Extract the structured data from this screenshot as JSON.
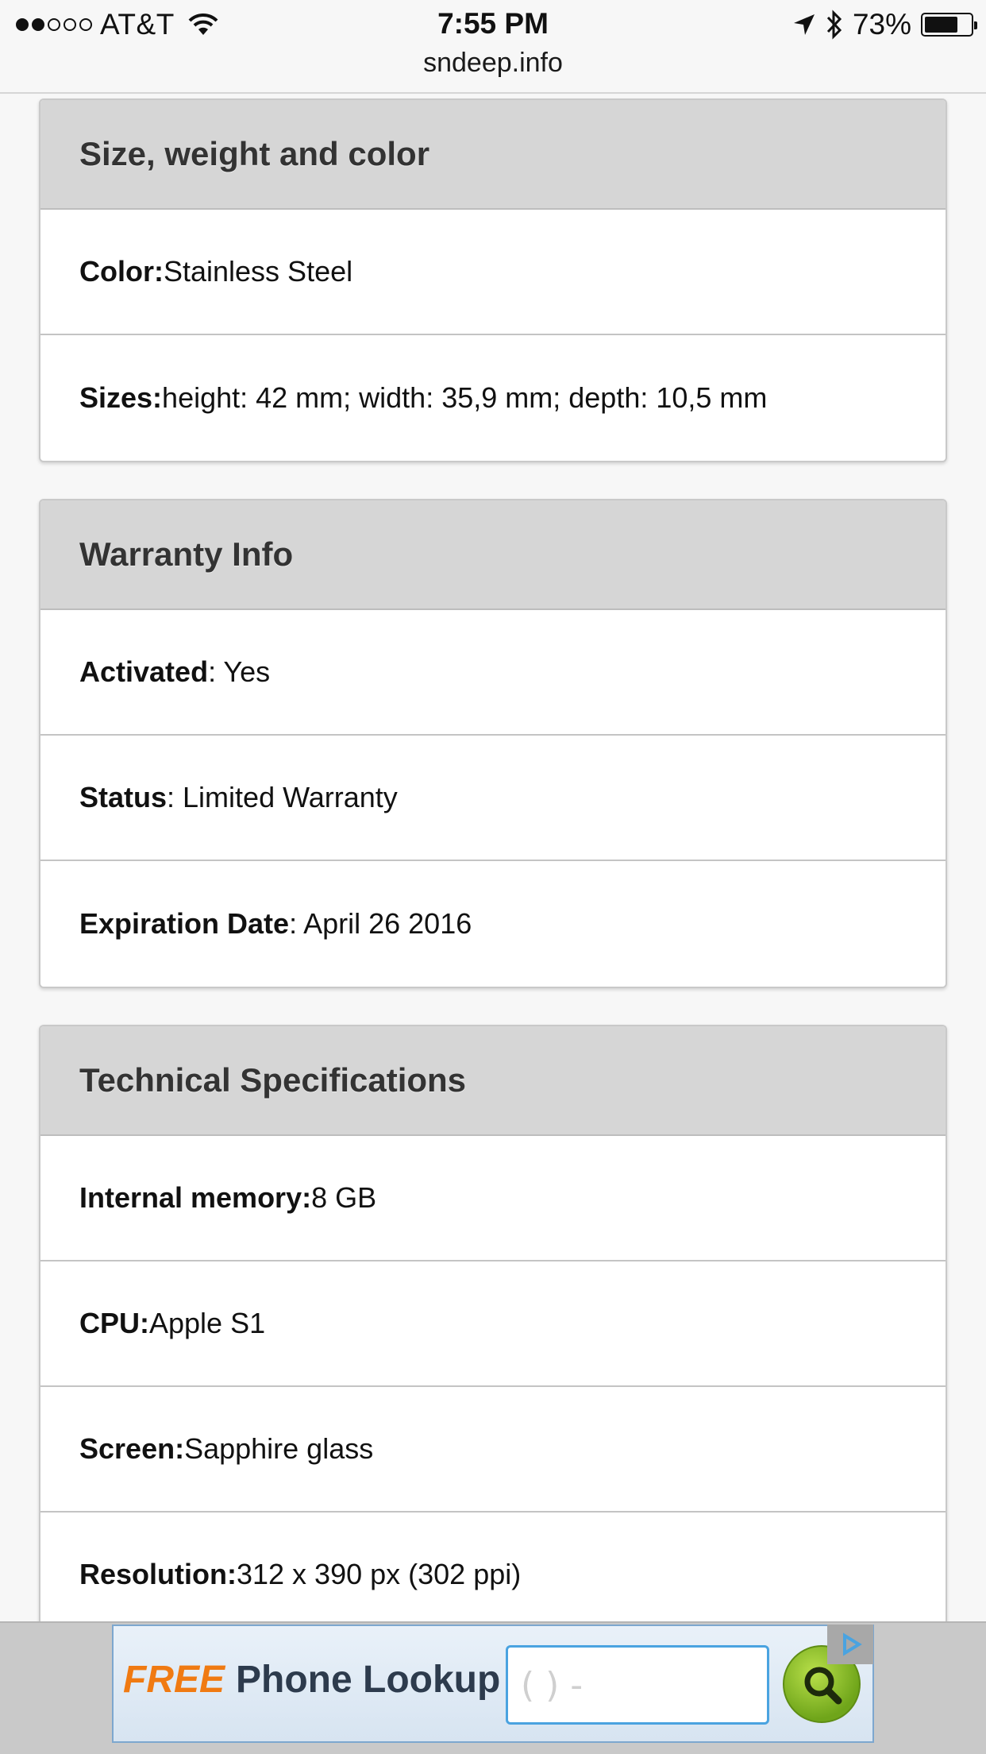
{
  "status_bar": {
    "carrier": "AT&T",
    "time": "7:55 PM",
    "url": "sndeep.info",
    "battery_percent": "73%",
    "battery_level": 0.73
  },
  "sections": [
    {
      "title": "Size, weight and color",
      "rows": [
        {
          "label": "Color:",
          "value": " Stainless Steel"
        },
        {
          "label": "Sizes:",
          "value": " height: 42 mm; width: 35,9 mm; depth: 10,5 mm"
        }
      ]
    },
    {
      "title": "Warranty Info",
      "rows": [
        {
          "label": "Activated",
          "value": ": Yes"
        },
        {
          "label": "Status",
          "value": ": Limited Warranty"
        },
        {
          "label": "Expiration Date",
          "value": ": April 26 2016"
        }
      ]
    },
    {
      "title": "Technical Specifications",
      "rows": [
        {
          "label": "Internal memory:",
          "value": " 8 GB"
        },
        {
          "label": "CPU:",
          "value": " Apple S1"
        },
        {
          "label": "Screen:",
          "value": " Sapphire glass"
        },
        {
          "label": "Resolution:",
          "value": " 312 x 390 px (302 ppi)"
        }
      ]
    }
  ],
  "ad": {
    "free_label": "FREE",
    "text": "Phone Lookup",
    "input_placeholder": "(    )     -",
    "colors": {
      "free": "#f07a12",
      "search_button": "#8cc43a",
      "input_border": "#4aa3e0"
    }
  }
}
